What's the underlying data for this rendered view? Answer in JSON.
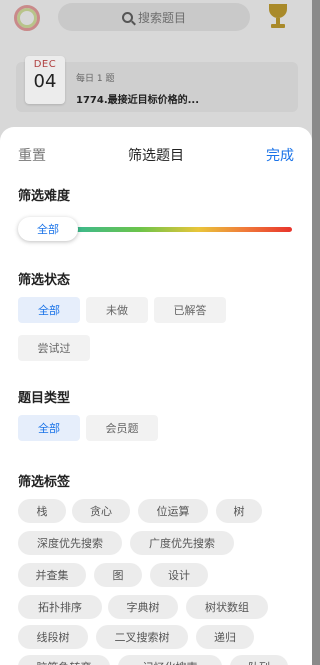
{
  "background": {
    "search_placeholder": "搜索题目",
    "daily": {
      "month": "DEC",
      "day": "04",
      "label": "每日 1 题",
      "title": "1774.最接近目标价格的..."
    }
  },
  "sheet": {
    "reset_label": "重置",
    "title": "筛选题目",
    "done_label": "完成",
    "difficulty": {
      "title": "筛选难度",
      "selected": "全部"
    },
    "status": {
      "title": "筛选状态",
      "options": [
        "全部",
        "未做",
        "已解答",
        "尝试过"
      ],
      "selected": "全部"
    },
    "type": {
      "title": "题目类型",
      "options": [
        "全部",
        "会员题"
      ],
      "selected": "全部"
    },
    "tags": {
      "title": "筛选标签",
      "items": [
        "栈",
        "贪心",
        "位运算",
        "树",
        "深度优先搜索",
        "广度优先搜索",
        "并查集",
        "图",
        "设计",
        "拓扑排序",
        "字典树",
        "树状数组",
        "线段树",
        "二叉搜索树",
        "递归",
        "脑筋急转弯",
        "记忆化搜索",
        "队列"
      ]
    }
  },
  "colors": {
    "accent": "#1a73e8",
    "selected_chip_bg": "#e6eefb",
    "chip_bg": "#f2f2f2",
    "tag_bg": "#ececec"
  }
}
